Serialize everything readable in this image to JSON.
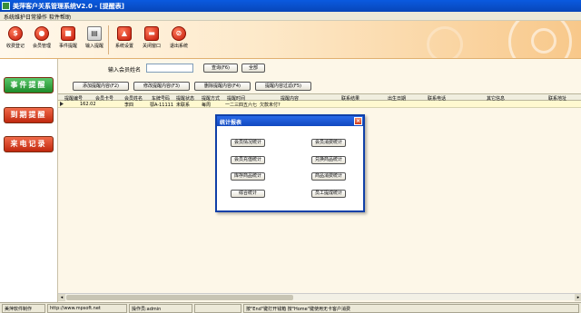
{
  "window": {
    "title": "美萍客户关系管理系统V2.0 - [提醒表]"
  },
  "menubar": {
    "items": [
      "系统维护",
      "日常操作",
      "软件帮助"
    ]
  },
  "toolbar": {
    "buttons": [
      {
        "label": "收费登记",
        "icon": "dollar-icon"
      },
      {
        "label": "会员管理",
        "icon": "user-icon"
      },
      {
        "label": "事件提醒",
        "icon": "bell-icon"
      },
      {
        "label": "输入提醒",
        "icon": "input-icon"
      },
      {
        "label": "系统设置",
        "icon": "settings-icon"
      },
      {
        "label": "关闭窗口",
        "icon": "close-window-icon"
      },
      {
        "label": "退出系统",
        "icon": "exit-icon"
      }
    ]
  },
  "sidebar": {
    "items": [
      {
        "label": "事件提醒",
        "color": "#2a9a3a"
      },
      {
        "label": "到期提醒",
        "color": "#d0321a"
      },
      {
        "label": "来电记录",
        "color": "#d0321a"
      }
    ]
  },
  "search": {
    "label": "输入会员姓名",
    "value": "",
    "query_button": "查询(F6)",
    "all_button": "全部"
  },
  "actions": [
    "添加提醒内容(F2)",
    "修改提醒内容(F3)",
    "删除提醒内容(F4)",
    "提醒内容过滤(F5)"
  ],
  "table": {
    "headers": [
      "提醒编号",
      "会员卡号",
      "会员姓名",
      "车牌号码",
      "提醒状态",
      "提醒方式",
      "提醒时间",
      "提醒内容",
      "联系结果",
      "出生日期",
      "联系电话",
      "其它信息",
      "联系地址"
    ],
    "rows": [
      [
        "",
        "162.02",
        "",
        "李四",
        "鄂A-11111",
        "未联系",
        "每周",
        "一二三四五六七",
        "欠款未付?",
        "",
        "",
        "",
        ""
      ]
    ]
  },
  "dialog": {
    "title": "统计报表",
    "buttons": [
      "会员情况统计",
      "会员消费统计",
      "会员充值统计",
      "兑换商品统计",
      "库存商品统计",
      "商品消费统计",
      "综合统计",
      "员工提成统计"
    ]
  },
  "statusbar": {
    "cells": [
      "美萍软件制作",
      "http://www.mpsoft.net",
      "操作员:admin",
      "",
      "按\"End\"键打开钱箱  按\"Home\"键使用无卡客户消费"
    ]
  }
}
